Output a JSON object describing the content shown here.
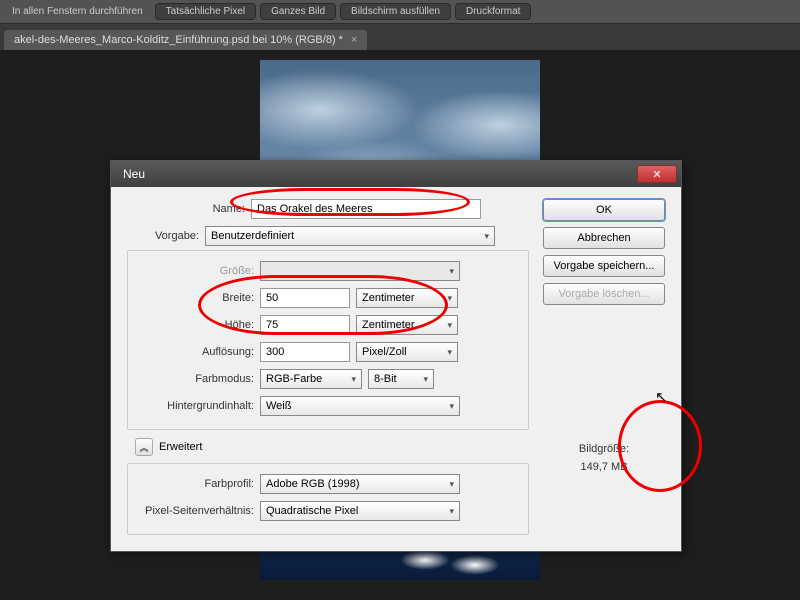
{
  "toolbar": {
    "label": "In allen Fenstern durchführen",
    "buttons": [
      "Tatsächliche Pixel",
      "Ganzes Bild",
      "Bildschirm ausfüllen",
      "Druckformat"
    ]
  },
  "tab": {
    "title": "akel-des-Meeres_Marco-Kolditz_Einführung.psd bei 10% (RGB/8) *",
    "close": "×"
  },
  "dialog": {
    "title": "Neu",
    "close": "✕",
    "labels": {
      "name": "Name:",
      "preset": "Vorgabe:",
      "size": "Größe:",
      "width": "Breite:",
      "height": "Höhe:",
      "resolution": "Auflösung:",
      "colormode": "Farbmodus:",
      "background": "Hintergrundinhalt:",
      "advanced": "Erweitert",
      "profile": "Farbprofil:",
      "aspect": "Pixel-Seitenverhältnis:"
    },
    "values": {
      "name": "Das Orakel des Meeres",
      "preset": "Benutzerdefiniert",
      "size": "",
      "width": "50",
      "height": "75",
      "resolution": "300",
      "width_unit": "Zentimeter",
      "height_unit": "Zentimeter",
      "res_unit": "Pixel/Zoll",
      "colormode": "RGB-Farbe",
      "bits": "8-Bit",
      "background": "Weiß",
      "profile": "Adobe RGB (1998)",
      "aspect": "Quadratische Pixel"
    },
    "buttons": {
      "ok": "OK",
      "cancel": "Abbrechen",
      "save": "Vorgabe speichern...",
      "delete": "Vorgabe löschen..."
    },
    "sizeinfo": {
      "label": "Bildgröße:",
      "value": "149,7 MB"
    }
  }
}
